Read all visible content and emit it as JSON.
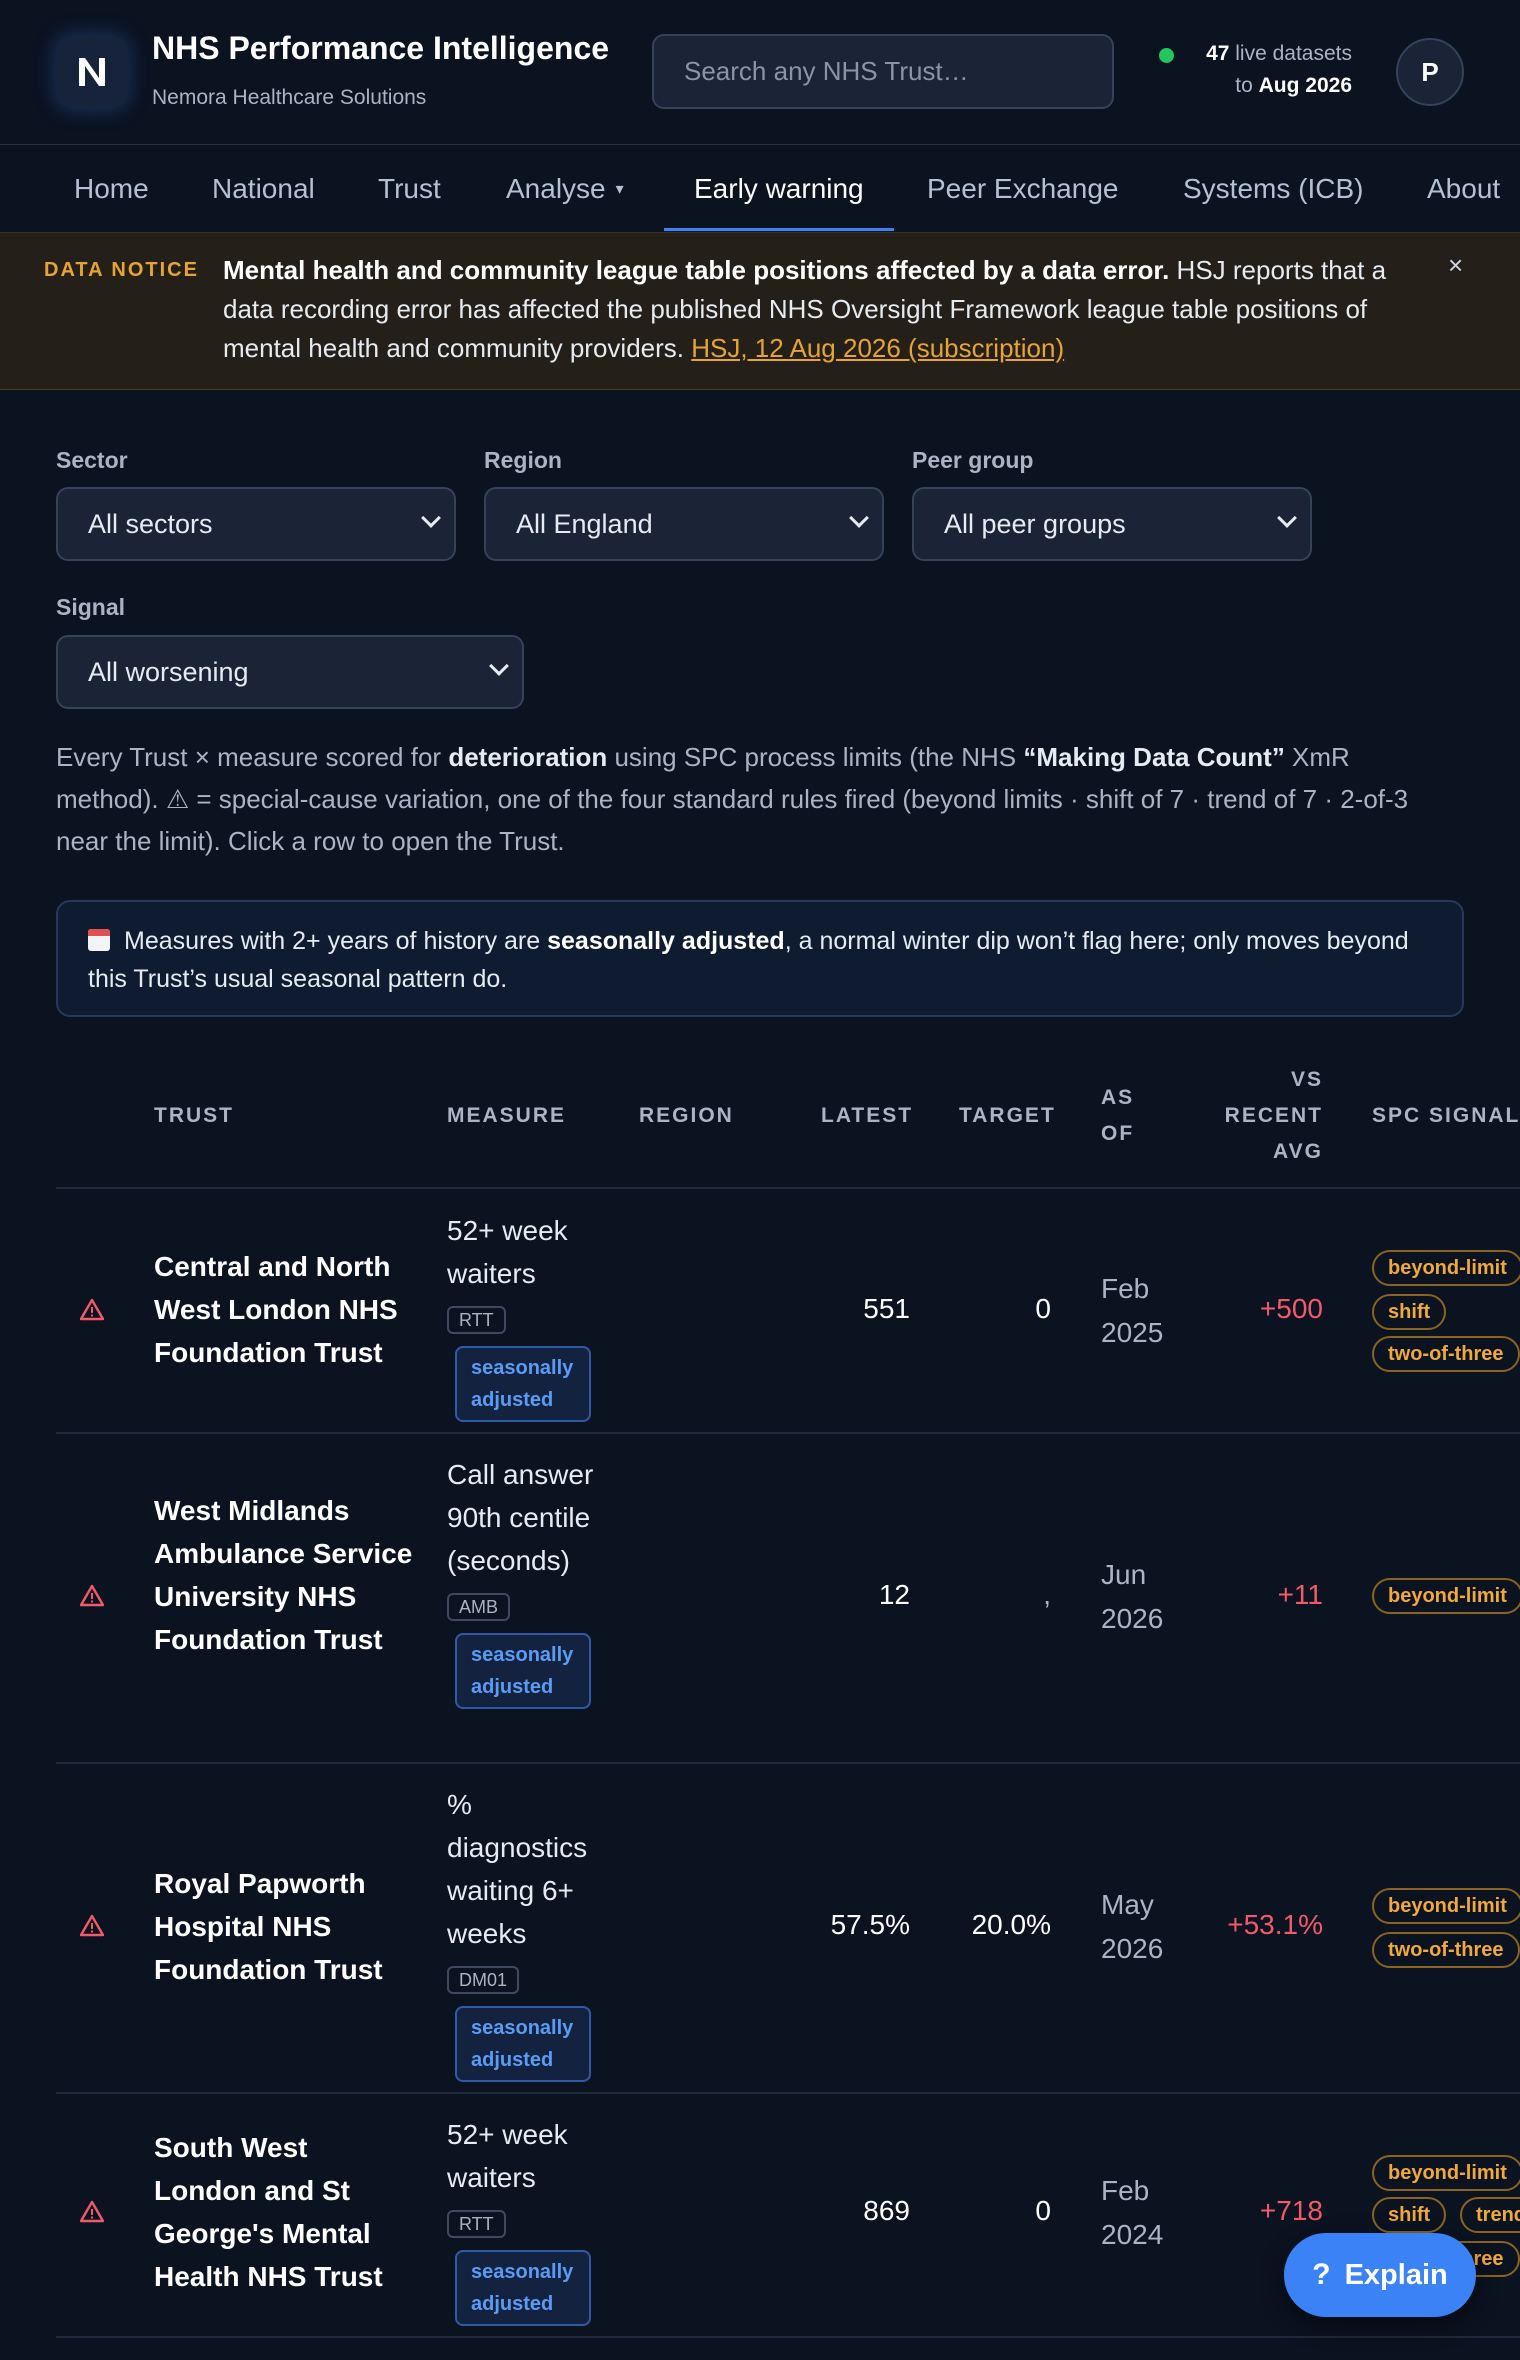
{
  "header": {
    "title": "NHS Performance Intelligence",
    "subtitle": "Nemora Healthcare Solutions",
    "logo_letter": "N",
    "search_placeholder": "Search any NHS Trust…",
    "live_count": "47",
    "live_text": "live datasets",
    "to_text": "to",
    "to_date": "Aug 2026",
    "avatar_letter": "P"
  },
  "nav": {
    "items": [
      "Home",
      "National",
      "Trust",
      "Analyse",
      "Early warning",
      "Peer Exchange",
      "Systems (ICB)",
      "About"
    ],
    "active": "Early warning"
  },
  "notice": {
    "label": "DATA NOTICE",
    "headline": "Mental health and community league table positions affected by a data error.",
    "body": " HSJ reports that a data recording error has affected the published NHS Oversight Framework league table positions of mental health and community providers. ",
    "link": "HSJ, 12 Aug 2026 (subscription)",
    "close": "×"
  },
  "filters": {
    "sector": {
      "label": "Sector",
      "value": "All sectors"
    },
    "region": {
      "label": "Region",
      "value": "All England"
    },
    "peer_group": {
      "label": "Peer group",
      "value": "All peer groups"
    },
    "signal": {
      "label": "Signal",
      "value": "All worsening"
    }
  },
  "description": {
    "p1": "Every Trust × measure scored for ",
    "b1": "deterioration",
    "p2": " using SPC process limits (the NHS ",
    "b2": "“Making Data Count”",
    "p3": " XmR method). ⚠ = special-cause variation, one of the four standard rules fired (beyond limits · shift of 7 · trend of 7 · 2-of-3 near the limit). Click a row to open the Trust."
  },
  "info": {
    "p1": "Measures with 2+ years of history are ",
    "b1": "seasonally adjusted",
    "p2": ", a normal winter dip won’t flag here; only moves beyond this Trust’s usual seasonal pattern do."
  },
  "table": {
    "headers": {
      "trust": "TRUST",
      "measure": "MEASURE",
      "region": "REGION",
      "latest": "LATEST",
      "target": "TARGET",
      "as_of_1": "AS",
      "as_of_2": "OF",
      "vs_1": "VS",
      "vs_2": "RECENT",
      "vs_3": "AVG",
      "spc": "SPC SIGNAL"
    },
    "sa_label_1": "seasonally",
    "sa_label_2": "adjusted",
    "rows": [
      {
        "trust": "Central and North West London NHS Foundation Trust",
        "measure": "52+ week waiters",
        "code": "RTT",
        "region": "",
        "latest": "551",
        "target": "0",
        "as_of_month": "Feb",
        "as_of_year": "2025",
        "delta": "+500",
        "signals": [
          "beyond-limit",
          "shift",
          "two-of-three"
        ]
      },
      {
        "trust": "West Midlands Ambulance Service University NHS Foundation Trust",
        "measure": "Call answer 90th centile (seconds)",
        "code": "AMB",
        "region": "",
        "latest": "12",
        "target": ",",
        "as_of_month": "Jun",
        "as_of_year": "2026",
        "delta": "+11",
        "signals": [
          "beyond-limit"
        ]
      },
      {
        "trust": "Royal Papworth Hospital NHS Foundation Trust",
        "measure": "% diagnostics waiting 6+ weeks",
        "code": "DM01",
        "region": "",
        "latest": "57.5%",
        "target": "20.0%",
        "as_of_month": "May",
        "as_of_year": "2026",
        "delta": "+53.1%",
        "signals": [
          "beyond-limit",
          "two-of-three"
        ]
      },
      {
        "trust": "South West London and St George's Mental Health NHS Trust",
        "measure": "52+ week waiters",
        "code": "RTT",
        "region": "",
        "latest": "869",
        "target": "0",
        "as_of_month": "Feb",
        "as_of_year": "2024",
        "delta": "+718",
        "signals": [
          "beyond-limit",
          "shift",
          "trend",
          "two-of-three"
        ]
      }
    ]
  },
  "explain": {
    "icon": "?",
    "label": "Explain"
  },
  "colors": {
    "accent": "#3b82f6",
    "warning": "#e6a532",
    "danger": "#f25a6b",
    "live": "#22c55e"
  }
}
